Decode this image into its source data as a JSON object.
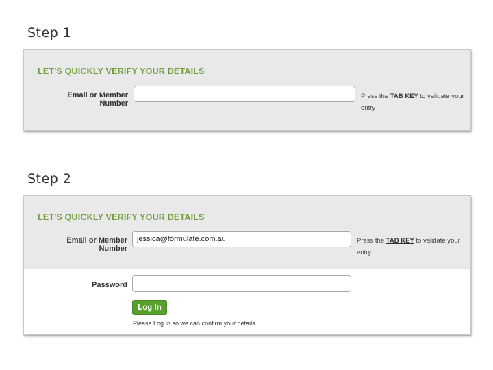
{
  "steps": [
    {
      "title": "Step 1",
      "heading": "LET'S QUICKLY VERIFY YOUR DETAILS",
      "email_label": "Email or Member Number",
      "email_value": "",
      "hint_pre": "Press the ",
      "hint_key": "TAB KEY",
      "hint_post": " to validate your entry"
    },
    {
      "title": "Step 2",
      "heading": "LET'S QUICKLY VERIFY YOUR DETAILS",
      "email_label": "Email or Member Number",
      "email_value": "jessica@formulate.com.au",
      "hint_pre": "Press the ",
      "hint_key": "TAB KEY",
      "hint_post": " to validate your entry",
      "password_label": "Password",
      "password_value": "",
      "login_label": "Log In",
      "note": "Please Log In so we can confirm your details."
    }
  ],
  "colors": {
    "heading_green": "#6e9a3a",
    "button_green": "#5aa02c",
    "panel_grey": "#e9e9e9"
  }
}
